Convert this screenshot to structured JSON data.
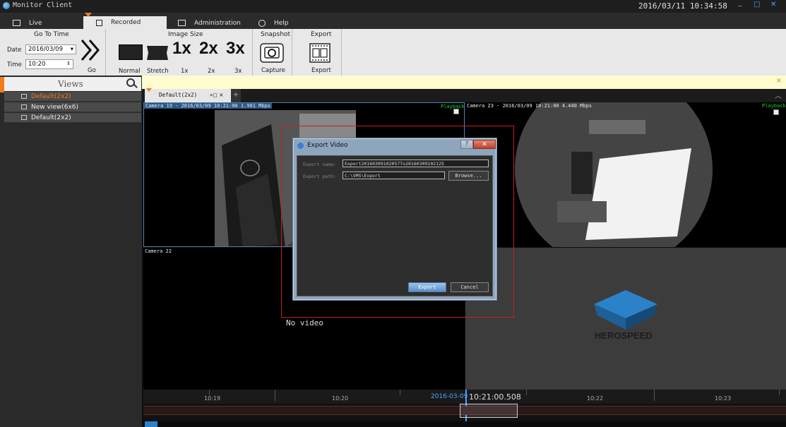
{
  "titlebar": {
    "app_title": "Monitor Client",
    "clock": "2016/03/11 10:34:58",
    "min": "–",
    "max": "□",
    "close": "✕"
  },
  "tabs": [
    {
      "label": "Live",
      "icon": "monitor-icon"
    },
    {
      "label": "Recorded",
      "icon": "play-icon"
    },
    {
      "label": "Administration",
      "icon": "folder-icon"
    },
    {
      "label": "Help",
      "icon": "question-icon"
    }
  ],
  "ribbon": {
    "goto": {
      "title": "Go To Time",
      "date_label": "Date",
      "date_value": "2016/03/09",
      "time_label": "Time",
      "time_value": "10:20",
      "go_label": "Go"
    },
    "image_size": {
      "title": "Image Size",
      "normal": "Normal",
      "stretch": "Stretch",
      "x1": "1x",
      "x2": "2x",
      "x3": "3x",
      "x1_glyph": "1x",
      "x2_glyph": "2x",
      "x3_glyph": "3x"
    },
    "snapshot": {
      "title": "Snapshot",
      "capture": "Capture"
    },
    "export": {
      "title": "Export",
      "export": "Export"
    }
  },
  "views": {
    "header": "Views",
    "items": [
      {
        "label": "Default(2x2)",
        "color": "#f07c1e"
      },
      {
        "label": "New view(6x6)",
        "color": "#eeeeee"
      },
      {
        "label": "Default(2x2)",
        "color": "#eeeeee"
      }
    ]
  },
  "notice": {
    "close": "×"
  },
  "grid_tab": {
    "label": "Default(2x2)",
    "controls": "»◻ ×",
    "add": "+"
  },
  "cameras": [
    {
      "header": "Camera 19 - 2016/03/09 10:21:00 1.901 Mbps",
      "playback": "Playback"
    },
    {
      "header": "Camera 23 - 2016/03/09 10:21:00 4.440 Mbps",
      "playback": "Playback"
    },
    {
      "header": "Camera 22"
    },
    {
      "header": "",
      "logo": "HEROSPEED"
    }
  ],
  "no_video": "No video",
  "timeline": {
    "ticks": [
      "10:19",
      "10:20",
      "10:21",
      "10:22",
      "10:23"
    ],
    "cursor_date": "2016-03-09",
    "cursor_time": "10:21:00.508"
  },
  "dialog": {
    "title": "Export Video",
    "help": "?",
    "close": "✕",
    "name_label": "Export name:",
    "name_value": "Export20160309102057To20160309102125",
    "path_label": "Export path:",
    "path_value": "C:\\VMS\\Export",
    "browse": "Browse...",
    "export": "Export",
    "cancel": "Cancel"
  }
}
